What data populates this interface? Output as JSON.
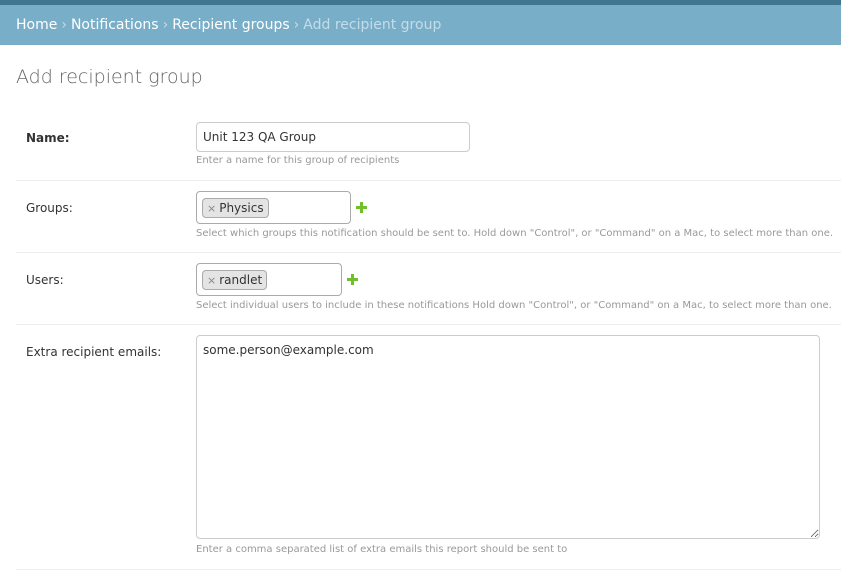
{
  "breadcrumbs": {
    "home": "Home",
    "notifications": "Notifications",
    "recipient_groups": "Recipient groups",
    "current": "Add recipient group",
    "separator": "›"
  },
  "page": {
    "title": "Add recipient group"
  },
  "form": {
    "name": {
      "label": "Name:",
      "value": "Unit 123 QA Group",
      "help": "Enter a name for this group of recipients"
    },
    "groups": {
      "label": "Groups:",
      "selected": [
        "Physics"
      ],
      "help": "Select which groups this notification should be sent to. Hold down \"Control\", or \"Command\" on a Mac, to select more than one."
    },
    "users": {
      "label": "Users:",
      "selected": [
        "randlet"
      ],
      "help": "Select individual users to include in these notifications Hold down \"Control\", or \"Command\" on a Mac, to select more than one."
    },
    "emails": {
      "label": "Extra recipient emails:",
      "value": "some.person@example.com",
      "help": "Enter a comma separated list of extra emails this report should be sent to"
    },
    "remove_glyph": "×"
  },
  "colors": {
    "header_bar": "#79aec8",
    "header_accent": "#417690",
    "add_icon": "#70bf2b"
  },
  "icons": {
    "add": "plus-icon",
    "remove": "close-icon",
    "resize": "resize-grip-icon"
  }
}
